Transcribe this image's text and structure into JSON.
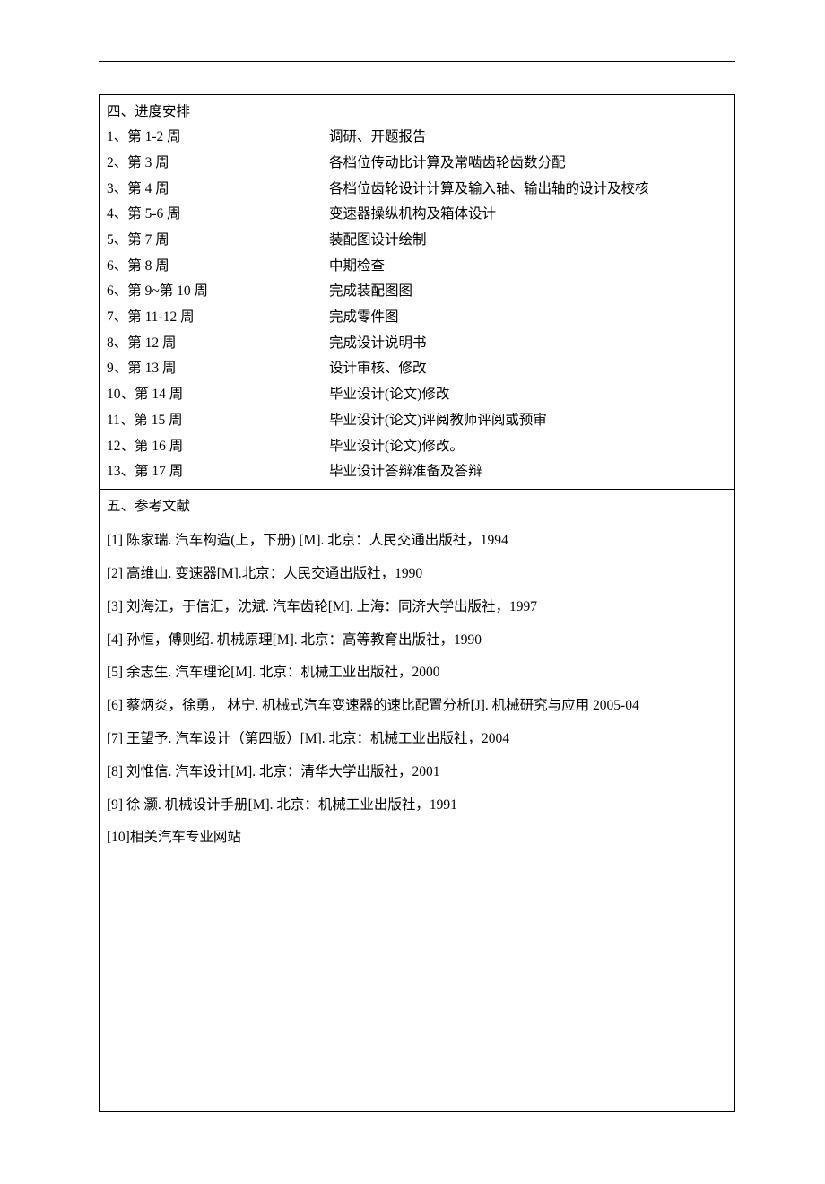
{
  "schedule": {
    "title": "四、进度安排",
    "rows": [
      {
        "left": "1、第 1-2 周",
        "right": "  调研、开题报告"
      },
      {
        "left": "2、第 3 周",
        "right": "各档位传动比计算及常啮齿轮齿数分配"
      },
      {
        "left": "3、第 4 周",
        "right": "各档位齿轮设计计算及输入轴、输出轴的设计及校核"
      },
      {
        "left": "4、第 5-6 周",
        "right": " 变速器操纵机构及箱体设计"
      },
      {
        "left": "5、第 7 周",
        "right": "装配图设计绘制"
      },
      {
        "left": "6、第 8 周",
        "right": "中期检查"
      },
      {
        "left": "6、第 9~第 10 周",
        "right": "完成装配图图"
      },
      {
        "left": "7、第 11-12 周",
        "right": "完成零件图"
      },
      {
        "left": "8、第 12 周",
        "right": "完成设计说明书"
      },
      {
        "left": "9、第 13 周",
        "right": "设计审核、修改"
      },
      {
        "left": "10、第 14 周",
        "right": "毕业设计(论文)修改"
      },
      {
        "left": "11、第 15 周",
        "right": "毕业设计(论文)评阅教师评阅或预审"
      },
      {
        "left": "12、第 16 周",
        "right": "毕业设计(论文)修改。"
      },
      {
        "left": "13、第 17 周",
        "right": "毕业设计答辩准备及答辩"
      }
    ]
  },
  "references": {
    "title": "五、参考文献",
    "items": [
      "[1] 陈家瑞. 汽车构造(上，下册) [M]. 北京：人民交通出版社，1994",
      "[2] 高维山. 变速器[M].北京：人民交通出版社，1990",
      "[3] 刘海江，于信汇，沈斌. 汽车齿轮[M]. 上海：同济大学出版社，1997",
      "[4] 孙恒，傅则绍. 机械原理[M]. 北京：高等教育出版社，1990",
      "[5] 余志生. 汽车理论[M]. 北京：机械工业出版社，2000",
      "[6] 蔡炳炎，徐勇， 林宁. 机械式汽车变速器的速比配置分析[J]. 机械研究与应用  2005-04",
      "[7] 王望予. 汽车设计（第四版）[M]. 北京：机械工业出版社，2004",
      "[8] 刘惟信. 汽车设计[M]. 北京：清华大学出版社，2001",
      "[9] 徐  灏. 机械设计手册[M]. 北京：机械工业出版社，1991",
      "[10]相关汽车专业网站"
    ]
  }
}
